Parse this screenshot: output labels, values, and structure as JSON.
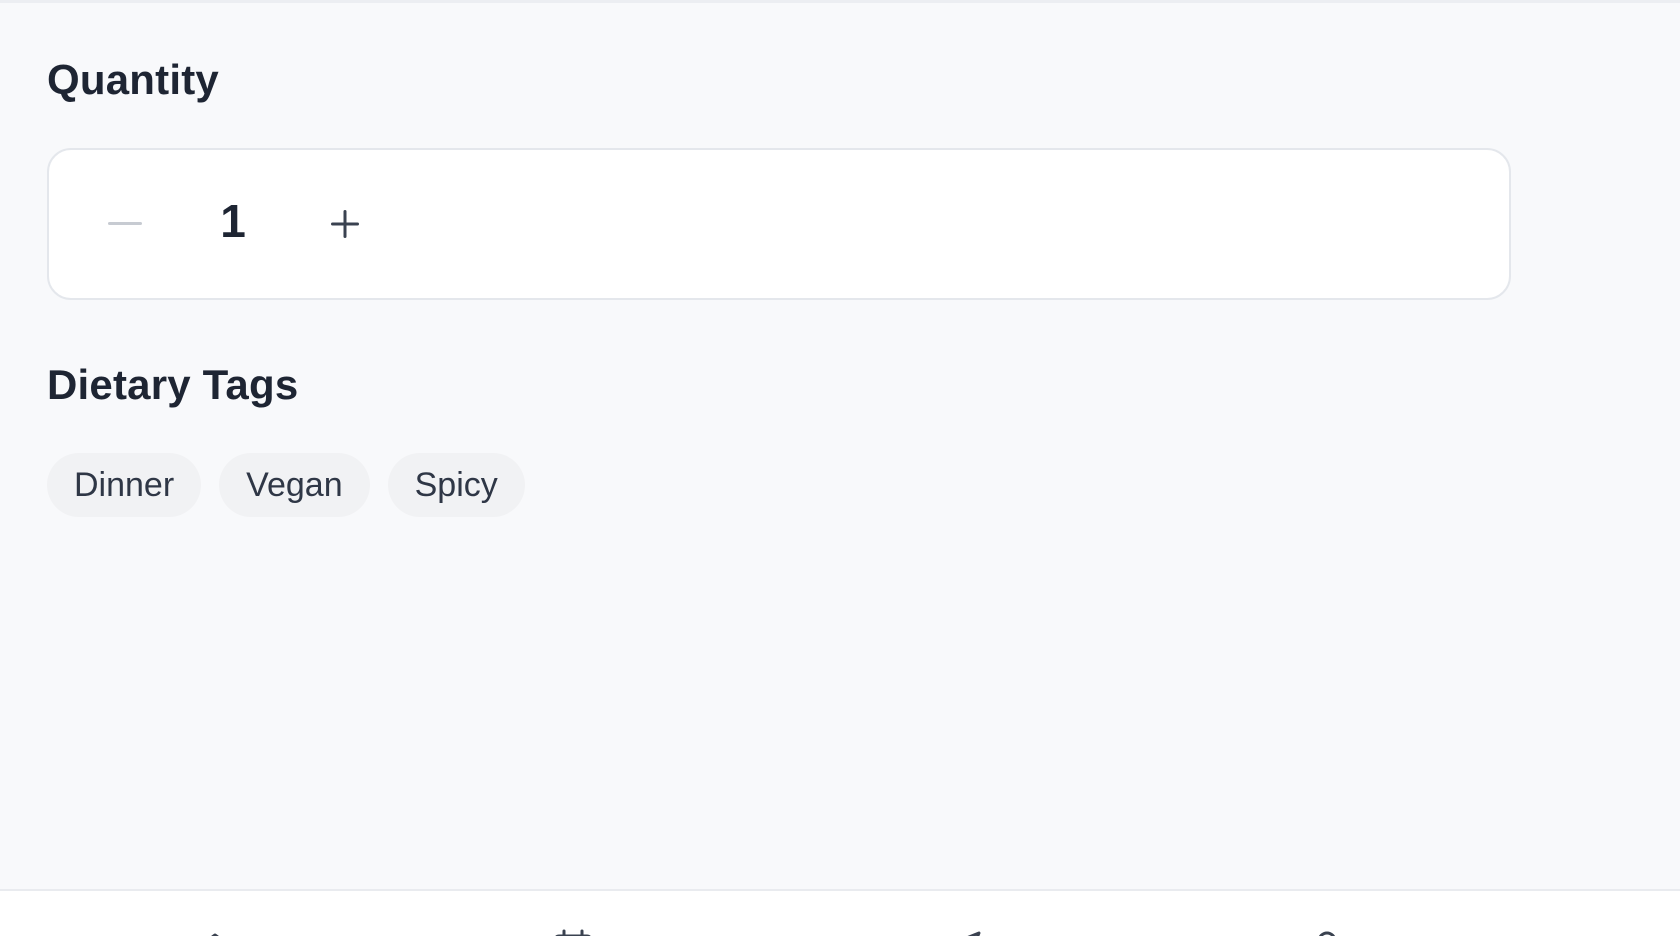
{
  "quantity": {
    "title": "Quantity",
    "value": "1",
    "decrement_icon": "minus-icon",
    "increment_icon": "plus-icon"
  },
  "dietary_tags": {
    "title": "Dietary Tags",
    "tags": [
      "Dinner",
      "Vegan",
      "Spicy"
    ]
  },
  "bottom_nav": {
    "items": [
      {
        "icon": "home-icon"
      },
      {
        "icon": "calendar-icon"
      },
      {
        "icon": "send-icon"
      },
      {
        "icon": "user-icon"
      }
    ]
  },
  "colors": {
    "background": "#f8f9fb",
    "card": "#ffffff",
    "text": "#1e2533",
    "tag_bg": "#f1f2f4",
    "muted_icon": "#c7cbd2"
  }
}
